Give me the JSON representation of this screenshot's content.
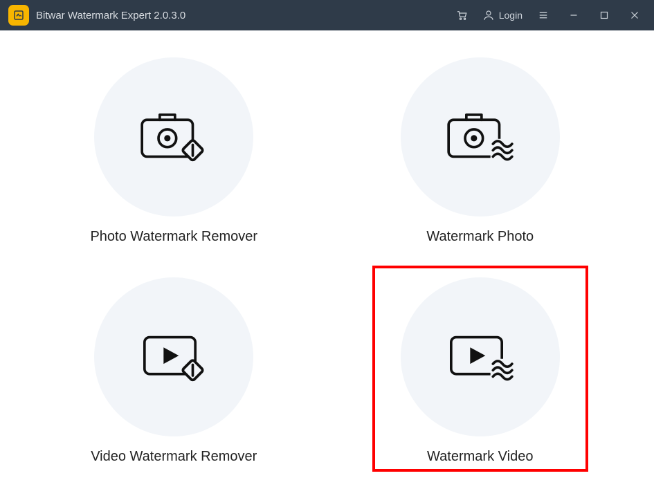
{
  "titlebar": {
    "app_title": "Bitwar Watermark Expert  2.0.3.0",
    "login_label": "Login"
  },
  "cards": {
    "photo_remover": {
      "label": "Photo Watermark Remover"
    },
    "watermark_photo": {
      "label": "Watermark Photo"
    },
    "video_remover": {
      "label": "Video Watermark Remover"
    },
    "watermark_video": {
      "label": "Watermark Video"
    }
  },
  "colors": {
    "titlebar_bg": "#2f3b49",
    "logo_bg": "#f7b500",
    "circle_bg": "#f2f5f9",
    "highlight": "#ff0000"
  }
}
